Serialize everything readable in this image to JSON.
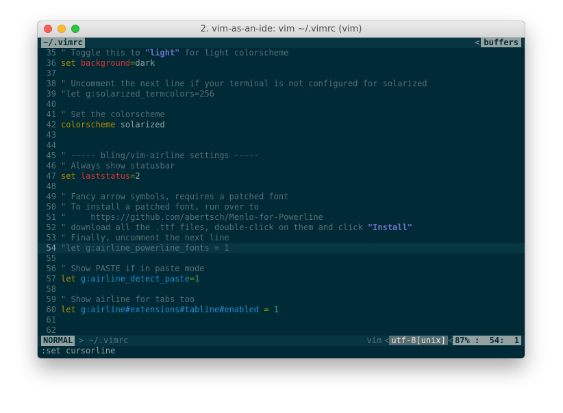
{
  "window": {
    "title": "2. vim-as-an-ide: vim ~/.vimrc (vim)"
  },
  "tabline": {
    "active_tab": "~/.vimrc",
    "right_sep": "<",
    "right_label": "buffers"
  },
  "editor": {
    "lines": [
      {
        "num": "35",
        "tokens": [
          {
            "t": "\" Toggle this to ",
            "c": "cmt"
          },
          {
            "t": "\"light\"",
            "c": "str"
          },
          {
            "t": " for light colorscheme",
            "c": "cmt"
          }
        ]
      },
      {
        "num": "36",
        "tokens": [
          {
            "t": "set ",
            "c": "kw"
          },
          {
            "t": "background",
            "c": "opt"
          },
          {
            "t": "=",
            "c": "eq"
          },
          {
            "t": "dark",
            "c": "tok"
          }
        ]
      },
      {
        "num": "37",
        "tokens": []
      },
      {
        "num": "38",
        "tokens": [
          {
            "t": "\" Uncomment the next line if your terminal is not configured for solarized",
            "c": "cmt"
          }
        ]
      },
      {
        "num": "39",
        "tokens": [
          {
            "t": "\"let g:solarized_termcolors=256",
            "c": "cmt"
          }
        ]
      },
      {
        "num": "40",
        "tokens": []
      },
      {
        "num": "41",
        "tokens": [
          {
            "t": "\" Set the colorscheme",
            "c": "cmt"
          }
        ]
      },
      {
        "num": "42",
        "tokens": [
          {
            "t": "colorscheme",
            "c": "kw"
          },
          {
            "t": " solarized",
            "c": "tok"
          }
        ]
      },
      {
        "num": "43",
        "tokens": []
      },
      {
        "num": "44",
        "tokens": []
      },
      {
        "num": "45",
        "tokens": [
          {
            "t": "\" ----- bling/vim-airline settings -----",
            "c": "cmt"
          }
        ]
      },
      {
        "num": "46",
        "tokens": [
          {
            "t": "\" Always show statusbar",
            "c": "cmt"
          }
        ]
      },
      {
        "num": "47",
        "tokens": [
          {
            "t": "set ",
            "c": "kw"
          },
          {
            "t": "laststatus",
            "c": "opt"
          },
          {
            "t": "=",
            "c": "eq"
          },
          {
            "t": "2",
            "c": "tok"
          }
        ]
      },
      {
        "num": "48",
        "tokens": []
      },
      {
        "num": "49",
        "tokens": [
          {
            "t": "\" Fancy arrow symbols, requires a patched font",
            "c": "cmt"
          }
        ]
      },
      {
        "num": "50",
        "tokens": [
          {
            "t": "\" To install a patched font, run over to",
            "c": "cmt"
          }
        ]
      },
      {
        "num": "51",
        "tokens": [
          {
            "t": "\"     https://github.com/abertsch/Menlo-for-Powerline",
            "c": "cmt"
          }
        ]
      },
      {
        "num": "52",
        "tokens": [
          {
            "t": "\" download all the .ttf files, double-click on them and click ",
            "c": "cmt"
          },
          {
            "t": "\"Install\"",
            "c": "str"
          }
        ]
      },
      {
        "num": "53",
        "tokens": [
          {
            "t": "\" Finally, uncomment the next line",
            "c": "cmt"
          }
        ]
      },
      {
        "num": "54",
        "current": true,
        "tokens": [
          {
            "t": "\"let g:airline_powerline_fonts = 1",
            "c": "cmt"
          }
        ]
      },
      {
        "num": "55",
        "tokens": []
      },
      {
        "num": "56",
        "tokens": [
          {
            "t": "\" Show PASTE if in paste mode",
            "c": "cmt"
          }
        ]
      },
      {
        "num": "57",
        "tokens": [
          {
            "t": "let ",
            "c": "kw"
          },
          {
            "t": "g:airline_detect_paste",
            "c": "var"
          },
          {
            "t": "=",
            "c": "eq"
          },
          {
            "t": "1",
            "c": "num"
          }
        ]
      },
      {
        "num": "58",
        "tokens": []
      },
      {
        "num": "59",
        "tokens": [
          {
            "t": "\" Show airline for tabs too",
            "c": "cmt"
          }
        ]
      },
      {
        "num": "60",
        "tokens": [
          {
            "t": "let ",
            "c": "kw"
          },
          {
            "t": "g:airline#extensions#tabline#enabled",
            "c": "var"
          },
          {
            "t": " = ",
            "c": "eq"
          },
          {
            "t": "1",
            "c": "num"
          }
        ]
      },
      {
        "num": "61",
        "tokens": []
      },
      {
        "num": "62",
        "tokens": []
      }
    ]
  },
  "statusline": {
    "mode": "NORMAL",
    "left_sep": ">",
    "file": "~/.vimrc",
    "filetype": "vim",
    "sep1": "<",
    "encoding": "utf-8[unix]",
    "sep2": "<",
    "position": "87% :  54:  1"
  },
  "cmdline": {
    "text": ":set cursorline"
  },
  "colors": {
    "background": "#002b36",
    "base02": "#073642",
    "comment": "#586e75",
    "keyword": "#b58900",
    "option": "#dc322f",
    "variable": "#268bd2",
    "number": "#2aa198",
    "string": "#6c71c4",
    "operator": "#859900"
  }
}
